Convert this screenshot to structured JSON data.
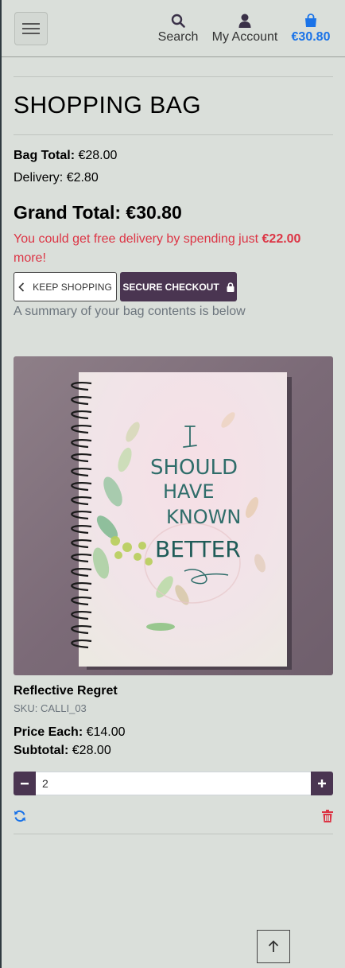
{
  "header": {
    "search_label": "Search",
    "account_label": "My Account",
    "bag_total": "€30.80"
  },
  "page": {
    "title": "SHOPPING BAG"
  },
  "summary": {
    "bag_total_label": "Bag Total:",
    "bag_total_value": "€28.00",
    "delivery_label": "Delivery:",
    "delivery_value": "€2.80",
    "grand_total_label": "Grand Total:",
    "grand_total_value": "€30.80",
    "free_delivery_prefix": "You could get free delivery by spending just",
    "free_delivery_amount": "€22.00",
    "free_delivery_suffix": "more!"
  },
  "buttons": {
    "keep_shopping": "KEEP SHOPPING",
    "secure_checkout": "SECURE CHECKOUT"
  },
  "bag_note": "A summary of your bag contents is below",
  "item": {
    "name": "Reflective Regret",
    "sku": "SKU: CALLI_03",
    "price_label": "Price Each:",
    "price_value": "€14.00",
    "subtotal_label": "Subtotal:",
    "subtotal_value": "€28.00",
    "quantity": "2",
    "image_text": [
      "I",
      "SHOULD",
      "HAVE",
      "KNOWN",
      "BETTER"
    ]
  },
  "colors": {
    "brand": "#4a3551",
    "accent_blue": "#1a73e8",
    "danger": "#dc3545",
    "background": "#dadfda"
  },
  "icons": {
    "menu": "hamburger-icon",
    "search": "search-icon",
    "account": "user-icon",
    "bag": "shopping-bag-icon",
    "keep": "chevron-left-icon",
    "checkout": "lock-icon",
    "update": "refresh-icon",
    "remove": "trash-icon",
    "top": "arrow-up-icon"
  }
}
